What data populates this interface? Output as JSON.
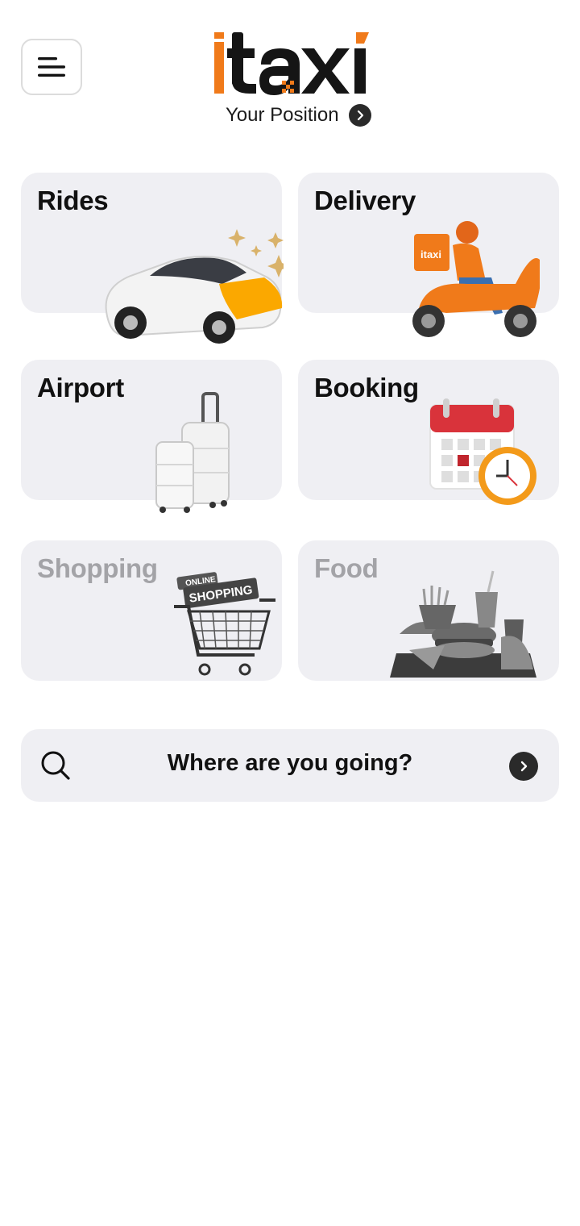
{
  "header": {
    "menu_icon": "hamburger-menu-icon",
    "logo": {
      "text": "itaxi",
      "brand_color": "#f07a1a",
      "dark_color": "#151515"
    },
    "position_label": "Your Position",
    "position_icon": "chevron-right-icon"
  },
  "services": [
    {
      "id": "rides",
      "label": "Rides",
      "icon": "car-icon",
      "enabled": true
    },
    {
      "id": "delivery",
      "label": "Delivery",
      "icon": "delivery-scooter-icon",
      "enabled": true
    },
    {
      "id": "airport",
      "label": "Airport",
      "icon": "luggage-icon",
      "enabled": true
    },
    {
      "id": "booking",
      "label": "Booking",
      "icon": "calendar-clock-icon",
      "enabled": true
    },
    {
      "id": "shopping",
      "label": "Shopping",
      "icon": "shopping-cart-icon",
      "enabled": false,
      "badge_top": "ONLINE",
      "badge_main": "SHOPPING"
    },
    {
      "id": "food",
      "label": "Food",
      "icon": "food-tray-icon",
      "enabled": false
    }
  ],
  "search": {
    "label": "Where are you going?",
    "icon": "search-icon",
    "action_icon": "chevron-right-icon"
  },
  "colors": {
    "accent": "#f7a600",
    "orange": "#f07a1a",
    "card_bg": "#efeff3",
    "disabled_text": "#a3a3a7",
    "calendar_red": "#d9333b"
  }
}
